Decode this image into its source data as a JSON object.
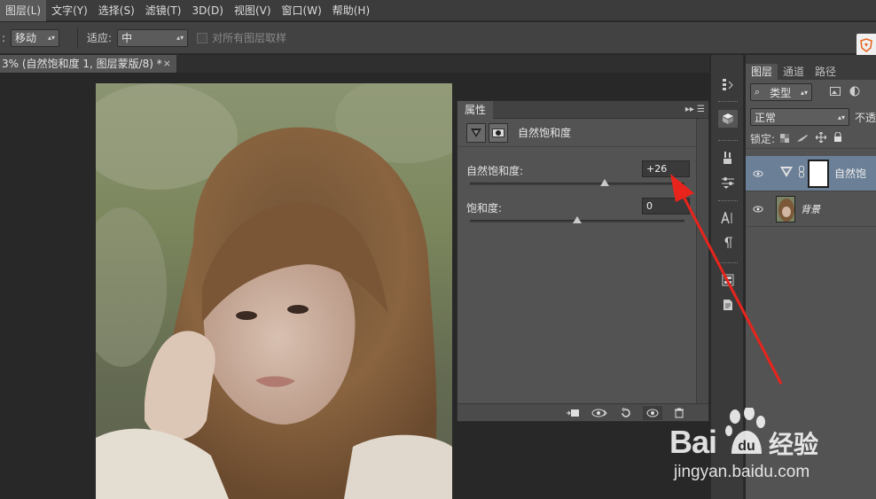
{
  "menu": {
    "items": [
      "图层(L)",
      "文字(Y)",
      "选择(S)",
      "滤镜(T)",
      "3D(D)",
      "视图(V)",
      "窗口(W)",
      "帮助(H)"
    ]
  },
  "options": {
    "leading_colon": ":",
    "mode_value": "移动",
    "fit_label": "适应:",
    "fit_value": "中",
    "sample_all_label": "对所有图层取样"
  },
  "document": {
    "tab_title": "3% (自然饱和度 1, 图层蒙版/8) *",
    "close_glyph": "×"
  },
  "properties": {
    "tab_label": "属性",
    "adjustment_name": "自然饱和度",
    "vibrance": {
      "label": "自然饱和度:",
      "value": "+26",
      "level": 0.63
    },
    "saturation": {
      "label": "饱和度:",
      "value": "0",
      "level": 0.5
    }
  },
  "layers": {
    "tabs": [
      "图层",
      "通道",
      "路径"
    ],
    "filter_kind": "类型",
    "blend_mode": "正常",
    "opacity_label": "不透",
    "lock_label": "锁定:",
    "items": [
      {
        "name": "自然饱",
        "selected": true
      },
      {
        "name": "背景",
        "selected": false
      }
    ]
  },
  "watermark": {
    "brand_left": "Bai",
    "brand_right": "经验",
    "url": "jingyan.baidu.com"
  },
  "colors": {
    "accent_arrow": "#e8241c",
    "selected_layer": "#6b7f97"
  }
}
